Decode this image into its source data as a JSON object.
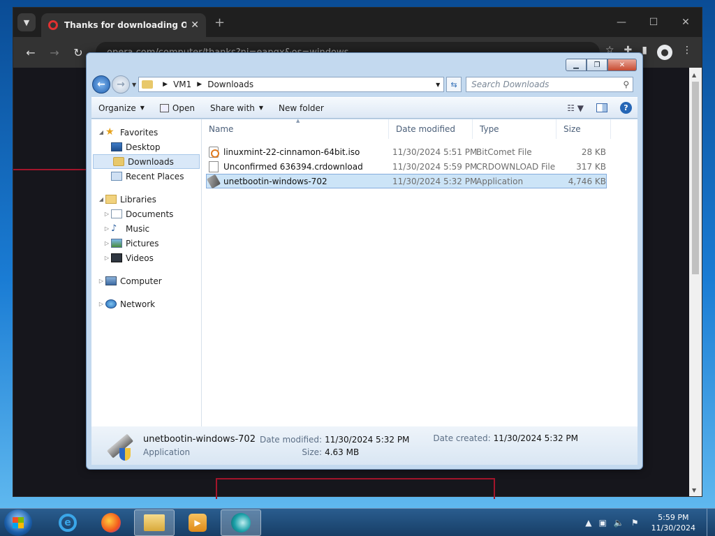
{
  "browser": {
    "tab_title": "Thanks for downloading Opera",
    "url": "opera.com/computer/thanks?ni=eapgx&os=windows",
    "new_tab_symbol": "+",
    "close_symbol": "✕"
  },
  "explorer": {
    "breadcrumb": [
      "VM1",
      "Downloads"
    ],
    "search_placeholder": "Search Downloads",
    "toolbar": {
      "organize": "Organize",
      "open": "Open",
      "share_with": "Share with",
      "new_folder": "New folder"
    },
    "nav": {
      "favorites": "Favorites",
      "desktop": "Desktop",
      "downloads": "Downloads",
      "recent": "Recent Places",
      "libraries": "Libraries",
      "documents": "Documents",
      "music": "Music",
      "pictures": "Pictures",
      "videos": "Videos",
      "computer": "Computer",
      "network": "Network"
    },
    "columns": {
      "name": "Name",
      "date": "Date modified",
      "type": "Type",
      "size": "Size"
    },
    "files": [
      {
        "name": "linuxmint-22-cinnamon-64bit.iso",
        "date": "11/30/2024 5:51 PM",
        "type": "BitComet File",
        "size": "28 KB"
      },
      {
        "name": "Unconfirmed 636394.crdownload",
        "date": "11/30/2024 5:59 PM",
        "type": "CRDOWNLOAD File",
        "size": "317 KB"
      },
      {
        "name": "unetbootin-windows-702",
        "date": "11/30/2024 5:32 PM",
        "type": "Application",
        "size": "4,746 KB"
      }
    ],
    "details": {
      "name": "unetbootin-windows-702",
      "kind": "Application",
      "date_modified_label": "Date modified:",
      "date_modified": "11/30/2024 5:32 PM",
      "size_label": "Size:",
      "size": "4.63 MB",
      "date_created_label": "Date created:",
      "date_created": "11/30/2024 5:32 PM"
    }
  },
  "taskbar": {
    "time": "5:59 PM",
    "date": "11/30/2024"
  }
}
